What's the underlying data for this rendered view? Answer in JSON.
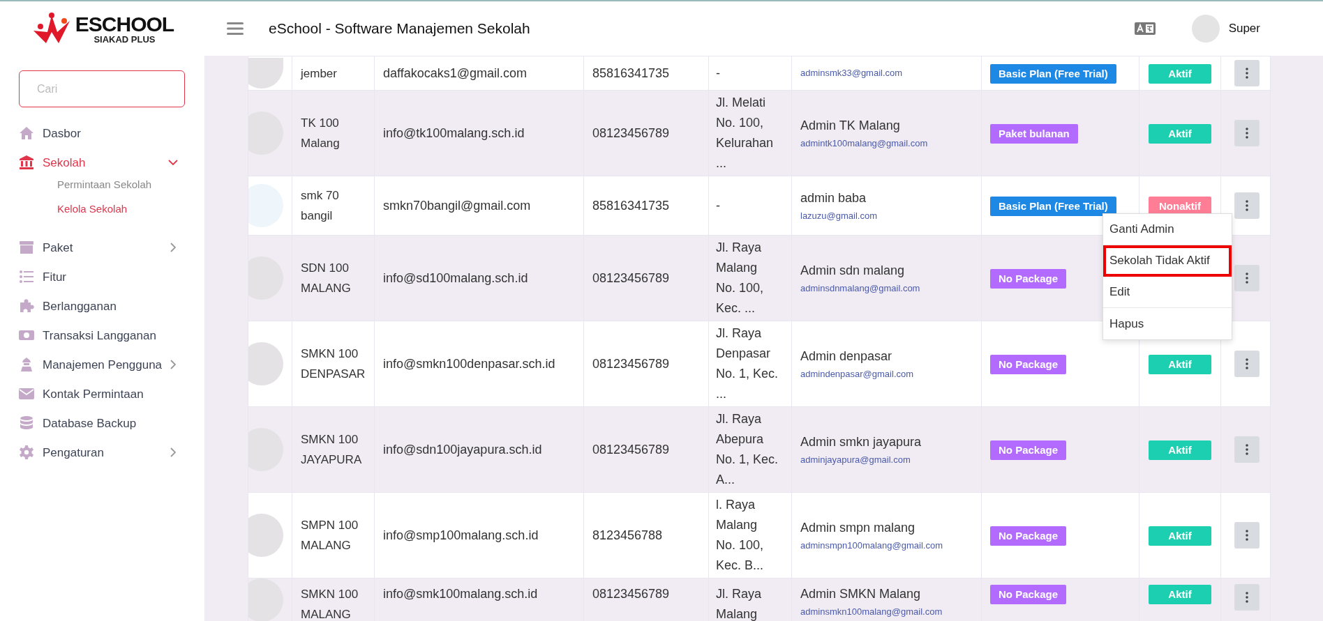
{
  "header": {
    "logo_title": "ESCHOOL",
    "logo_subtitle": "SIAKAD PLUS",
    "title": "eSchool - Software Manajemen Sekolah",
    "user_name": "Super"
  },
  "sidebar": {
    "search": {
      "placeholder": "Cari"
    },
    "items": [
      {
        "label": "Dasbor",
        "selected": false
      },
      {
        "label": "Sekolah",
        "selected": true,
        "expanded": true,
        "children": [
          {
            "label": "Permintaan Sekolah",
            "selected": false
          },
          {
            "label": "Kelola Sekolah",
            "selected": true
          }
        ]
      },
      {
        "label": "Paket",
        "selected": false,
        "expanded": false
      },
      {
        "label": "Fitur",
        "selected": false
      },
      {
        "label": "Berlangganan",
        "selected": false
      },
      {
        "label": "Transaksi Langganan",
        "selected": false
      },
      {
        "label": "Manajemen Pengguna",
        "selected": false,
        "expanded": false
      },
      {
        "label": "Kontak Permintaan",
        "selected": false
      },
      {
        "label": "Database Backup",
        "selected": false
      },
      {
        "label": "Pengaturan",
        "selected": false,
        "expanded": false
      }
    ]
  },
  "table": {
    "rows": [
      {
        "kind": "placeholder",
        "name": "jember",
        "email": "daffakocaks1@gmail.com",
        "phone": "85816341735",
        "address": "-",
        "admin_email": "adminsmk33@gmail.com",
        "package": "Basic Plan (Free Trial)",
        "color": "#1e88e5",
        "status": "Aktif",
        "active": true
      },
      {
        "kind": "placeholder",
        "name": "TK 100 Malang",
        "email": "info@tk100malang.sch.id",
        "phone": "08123456789",
        "address": "Jl. Melati No. 100, Kelurahan ...",
        "admin_name": "Admin TK Malang",
        "admin_email": "admintk100malang@gmail.com",
        "package": "Paket bulanan",
        "color": "#b36bff",
        "status": "Aktif",
        "active": true
      },
      {
        "kind": "logo",
        "name": "smk 70 bangil",
        "email": "smkn70bangil@gmail.com",
        "phone": "85816341735",
        "address": "-",
        "admin_name": "admin baba",
        "admin_email": "lazuzu@gmail.com",
        "package": "Basic Plan (Free Trial)",
        "color": "#1e88e5",
        "status": "Nonaktif",
        "active": false
      },
      {
        "kind": "placeholder",
        "name": "SDN 100 MALANG",
        "email": "info@sd100malang.sch.id",
        "phone": "08123456789",
        "address": "Jl. Raya Malang No. 100, Kec. ...",
        "admin_name": "Admin sdn malang",
        "admin_email": "adminsdnmalang@gmail.com",
        "package": "No Package",
        "color": "#b36bff"
      },
      {
        "kind": "placeholder",
        "name": "SMKN 100 DENPASAR",
        "email": "info@smkn100denpasar.sch.id",
        "phone": "08123456789",
        "address": "Jl. Raya Denpasar No. 1, Kec. ...",
        "admin_name": "Admin denpasar",
        "admin_email": "admindenpasar@gmail.com",
        "package": "No Package",
        "color": "#b36bff",
        "status": "Aktif",
        "active": true
      },
      {
        "kind": "placeholder",
        "name": "SMKN 100 JAYAPURA",
        "email": "info@sdn100jayapura.sch.id",
        "phone": "08123456789",
        "address": "Jl. Raya Abepura No. 1, Kec. A...",
        "admin_name": "Admin smkn jayapura",
        "admin_email": "adminjayapura@gmail.com",
        "package": "No Package",
        "color": "#b36bff",
        "status": "Aktif",
        "active": true
      },
      {
        "kind": "placeholder",
        "name": "SMPN 100 MALANG",
        "email": "info@smp100malang.sch.id",
        "phone": "8123456788",
        "address": "l. Raya Malang No. 100, Kec. B...",
        "admin_name": "Admin smpn malang",
        "admin_email": "adminsmpn100malang@gmail.com",
        "package": "No Package",
        "color": "#b36bff",
        "status": "Aktif",
        "active": true
      },
      {
        "kind": "placeholder",
        "name": "SMKN 100 MALANG",
        "email": "info@smk100malang.sch.id",
        "phone": "08123456789",
        "address": "Jl. Raya Malang",
        "admin_name": "Admin SMKN Malang",
        "admin_email": "adminsmkn100malang@gmail.com",
        "package": "No Package",
        "color": "#b36bff",
        "status": "Aktif",
        "active": true
      }
    ]
  },
  "action_menu": {
    "items": [
      {
        "label": "Ganti Admin",
        "highlighted": false
      },
      {
        "label": "Sekolah Tidak Aktif",
        "highlighted": true
      },
      {
        "label": "Edit",
        "highlighted": false
      },
      {
        "label": "Hapus",
        "highlighted": false
      }
    ]
  }
}
